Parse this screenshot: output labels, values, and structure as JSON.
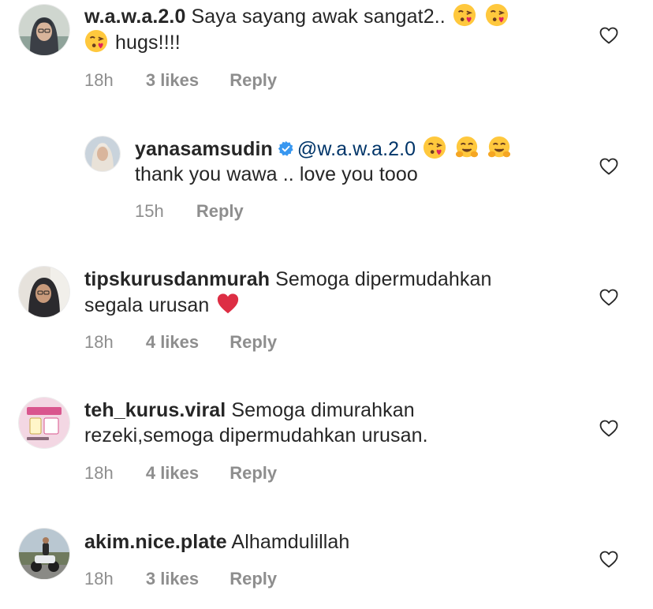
{
  "comments": [
    {
      "username": "w.a.w.a.2.0",
      "text_before": "Saya sayang awak sangat2..",
      "text_after": "hugs!!!!",
      "time": "18h",
      "likes": "3 likes",
      "reply": "Reply",
      "avatar_icon": "hijab-avatar-icon"
    },
    {
      "username": "yanasamsudin",
      "verified": true,
      "mention": "@w.a.w.a.2.0",
      "text": "thank you wawa .. love you tooo",
      "time": "15h",
      "reply": "Reply",
      "avatar_icon": "profile-photo-icon"
    },
    {
      "username": "tipskurusdanmurah",
      "text_before": "Semoga dipermudahkan",
      "text_after": "segala urusan",
      "time": "18h",
      "likes": "4 likes",
      "reply": "Reply",
      "avatar_icon": "hijab-avatar-icon"
    },
    {
      "username": "teh_kurus.viral",
      "text_before": "Semoga dimurahkan",
      "text_after": "rezeki,semoga dipermudahkan urusan.",
      "time": "18h",
      "likes": "4 likes",
      "reply": "Reply",
      "avatar_icon": "product-avatar-icon"
    },
    {
      "username": "akim.nice.plate",
      "text": "Alhamdulillah",
      "time": "18h",
      "likes": "3 likes",
      "reply": "Reply",
      "avatar_icon": "motorbike-avatar-icon"
    }
  ],
  "icons": {
    "like": "heart-outline-icon",
    "verified": "verified-badge-icon",
    "kiss_emoji": "face-blowing-kiss-emoji",
    "hug_emoji": "hugging-face-emoji",
    "heart_emoji": "red-heart-emoji"
  },
  "colors": {
    "text": "#262626",
    "meta": "#8e8e8e",
    "mention": "#003569",
    "verified": "#3897f0"
  }
}
